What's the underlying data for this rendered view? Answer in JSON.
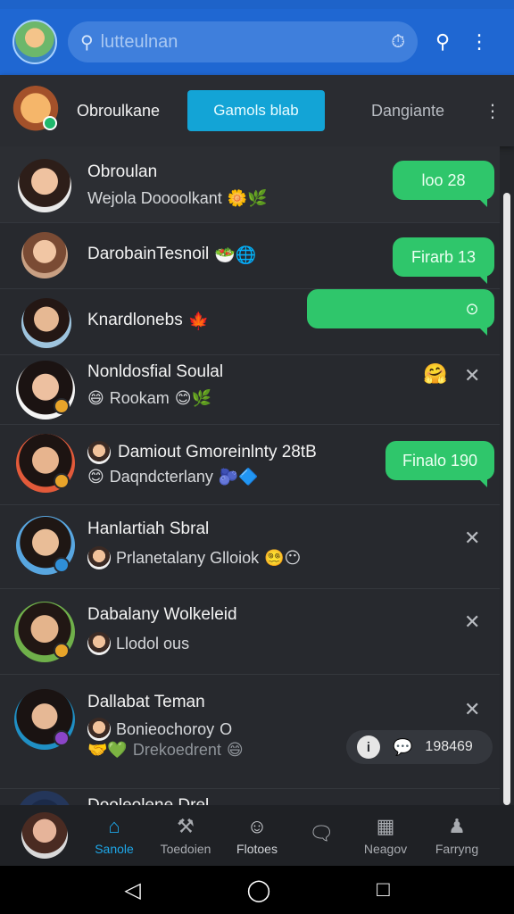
{
  "search": {
    "placeholder": "lutteulnan"
  },
  "tabs_bar": {
    "user_name": "Obroulkane",
    "active_tab": "Gamols blab",
    "tab": "Dangiante"
  },
  "chats": [
    {
      "name": "Obroulan",
      "preview": "Wejola Doooolkant",
      "preview_emoji": "🌼🌿",
      "pill": "loo 28"
    },
    {
      "name": "DarobainTesnoil",
      "name_emoji": "🥗🌐",
      "pill": "Firarb 13"
    },
    {
      "name": "Knardlonebs",
      "name_emoji": "🍁",
      "pill_icon": "⊙"
    },
    {
      "name": "Nonldosfial Soulal",
      "preview": "Rookam",
      "preview_emoji": "😊🌿",
      "lead_emoji": "😄",
      "side_emoji": "🤗"
    },
    {
      "name": "Damiout Gmoreinlnty 28tB",
      "preview": "Daqndcterlany",
      "preview_emoji": "🫐🔷",
      "pill": "Finalo 190"
    },
    {
      "name": "Hanlartiah Sbral",
      "preview": "Prlanetalany Glloiok",
      "preview_emoji": "😵‍💫😶"
    },
    {
      "name": "Dabalany Wolkeleid",
      "preview": "Llodol ous"
    },
    {
      "name": "Dallabat Teman",
      "preview": "Bonieochoroy",
      "preview_suffix": "O",
      "preview2": "Drekoedrent",
      "preview2_emoji": "😄"
    },
    {
      "name": "Dooleolene Drel"
    }
  ],
  "stat_chip": {
    "value": "198469"
  },
  "nav": {
    "items": [
      "Sanole",
      "Toedoien",
      "Flotoes",
      "",
      "Neagov",
      "Farryng"
    ]
  },
  "colors": {
    "accent_blue": "#1f67d2",
    "pill_green": "#2fc66b",
    "active_tab": "#13a4d6",
    "nav_active": "#1ea7e8"
  }
}
